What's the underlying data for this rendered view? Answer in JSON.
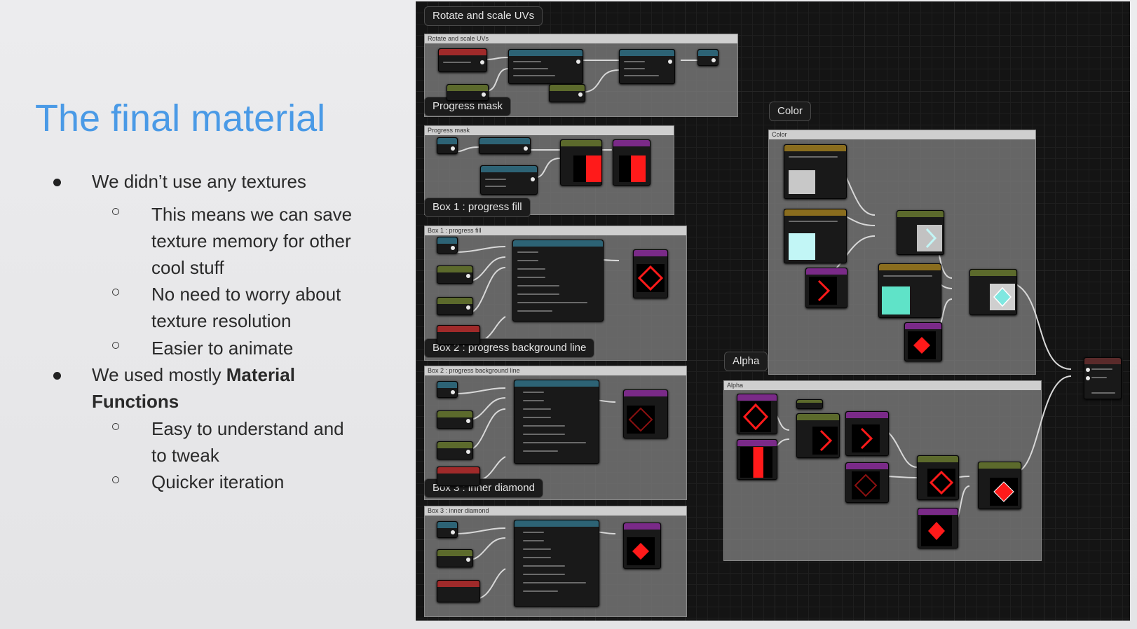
{
  "slide": {
    "title": "The final material",
    "bullets": [
      {
        "text": "We didn’t use any textures",
        "sub": [
          "This means we can save texture memory for other cool stuff",
          "No need to worry about texture resolution",
          "Easier to animate"
        ]
      },
      {
        "text_before": "We used mostly ",
        "text_bold": "Material Functions",
        "sub": [
          "Easy to understand and to tweak",
          "Quicker iteration"
        ]
      }
    ],
    "lines": {
      "b1": "We didn’t use any textures",
      "s1a": "This means we can save",
      "s1b": "texture memory for other",
      "s1c": "cool stuff",
      "s2a": "No need to worry about",
      "s2b": "texture resolution",
      "s3": "Easier to animate",
      "b2a": "We used mostly ",
      "b2bold": "Material",
      "b2c": "Functions",
      "s4a": "Easy to understand and",
      "s4b": "to tweak",
      "s5": "Quicker iteration"
    }
  },
  "graph": {
    "bubbles": {
      "rotate": "Rotate and scale UVs",
      "progress_mask": "Progress mask",
      "box1": "Box 1 : progress fill",
      "box2": "Box 2 : progress background line",
      "box3": "Box 3 : inner diamond",
      "color": "Color",
      "alpha": "Alpha"
    },
    "comments": {
      "rotate": "Rotate and scale UVs",
      "progress_mask": "Progress mask",
      "box1": "Box 1 : progress fill",
      "box2": "Box 2 : progress background line",
      "box3": "Box 3 : inner diamond",
      "color": "Color",
      "alpha": "Alpha"
    },
    "colors": {
      "swatch_gray": "#c8c8c8",
      "swatch_lightcyan": "#c2f6f6",
      "swatch_teal": "#5fe3c8",
      "diamond_cyan": "#7fe7e0",
      "red": "#ff1a1a",
      "title_blue": "#4a9ae6"
    }
  }
}
